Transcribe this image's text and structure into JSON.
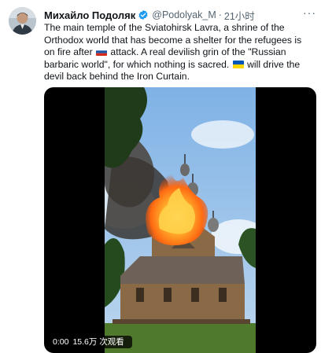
{
  "tweet": {
    "display_name": "Михайло Подоляк",
    "handle": "@Podolyak_M",
    "separator": "·",
    "time": "21小时",
    "more_icon": "more-icon",
    "text_part1": "The main temple of the Sviatohirsk Lavra, a shrine of the Orthodox world that has become a shelter for the refugees is on fire after ",
    "text_part2": " attack. A real devilish grin of the \"Russian barbaric world\", for which nothing is sacred. ",
    "text_part3": " will drive the devil back behind the Iron Curtain.",
    "flag_ru": "russia-flag-icon",
    "flag_ua": "ukraine-flag-icon"
  },
  "video": {
    "elapsed": "0:00",
    "views": "15.6万 次观看"
  },
  "colors": {
    "verified": "#1d9bf0",
    "secondary_text": "#536471",
    "primary_text": "#0f1419"
  }
}
